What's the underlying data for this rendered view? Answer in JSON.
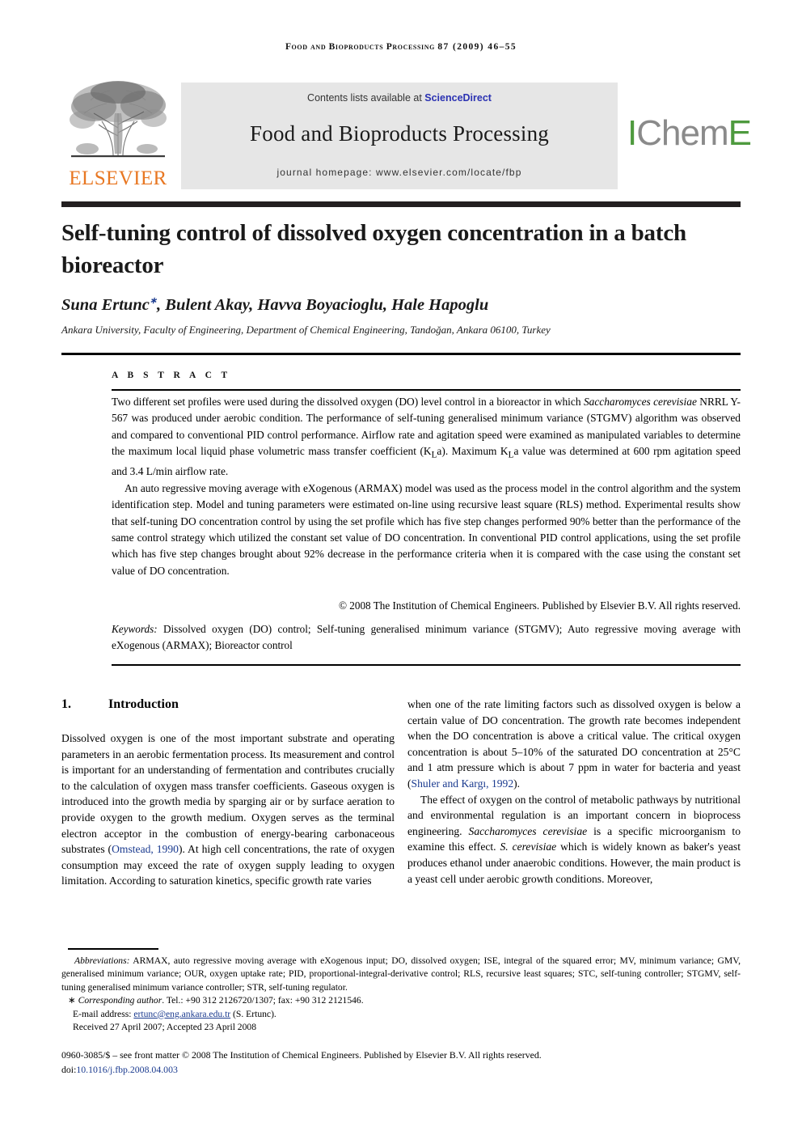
{
  "running_head": {
    "journal": "Food and Bioproducts Processing",
    "volume_issue": "87  (2009) 46–55"
  },
  "masthead": {
    "elsevier_wordmark": "ELSEVIER",
    "elsevier_logo_icon": "elsevier-tree-logo",
    "contents_prefix": "Contents lists available at ",
    "sciencedirect": "ScienceDirect",
    "journal_title": "Food and Bioproducts Processing",
    "homepage": "journal homepage: www.elsevier.com/locate/fbp",
    "icheme_part1": "I",
    "icheme_part2": "Chem",
    "icheme_part3": "E",
    "accent_green": "#4e9a3e",
    "accent_gray": "#8a8a8a",
    "elsevier_orange": "#E87722",
    "link_blue": "#2b32b2"
  },
  "article": {
    "title": "Self-tuning control of dissolved oxygen concentration in a batch bioreactor",
    "authors": "Suna Ertunc",
    "authors_rest": ", Bulent Akay, Havva Boyacioglu, Hale Hapoglu",
    "corresponding_marker": "∗",
    "affiliation": "Ankara University, Faculty of Engineering, Department of Chemical Engineering, Tandoğan, Ankara 06100, Turkey"
  },
  "abstract": {
    "label": "A B S T R A C T",
    "para1_a": "Two different set profiles were used during the dissolved oxygen (DO) level control in a bioreactor in which ",
    "para1_italic1": "Saccharomyces cerevisiae",
    "para1_b": " NRRL Y-567 was produced under aerobic condition. The performance of self-tuning generalised minimum variance (STGMV) algorithm was observed and compared to conventional PID control performance. Airflow rate and agitation speed were examined as manipulated variables to determine the maximum local liquid phase volumetric mass transfer coefficient (K",
    "para1_sub1": "L",
    "para1_c": "a). Maximum K",
    "para1_sub2": "L",
    "para1_d": "a value was determined at 600 rpm agitation speed and 3.4 L/min airflow rate.",
    "para2": "An auto regressive moving average with eXogenous (ARMAX) model was used as the process model in the control algorithm and the system identification step. Model and tuning parameters were estimated on-line using recursive least square (RLS) method. Experimental results show that self-tuning DO concentration control by using the set profile which has five step changes performed 90% better than the performance of the same control strategy which utilized the constant set value of DO concentration. In conventional PID control applications, using the set profile which has five step changes brought about 92% decrease in the performance criteria when it is compared with the case using the constant set value of DO concentration.",
    "copyright": "© 2008 The Institution of Chemical Engineers. Published by Elsevier B.V. All rights reserved.",
    "keywords_label": "Keywords:",
    "keywords_text": "  Dissolved oxygen (DO) control; Self-tuning generalised minimum variance (STGMV); Auto regressive moving average with eXogenous (ARMAX); Bioreactor control"
  },
  "body": {
    "section_number": "1.",
    "section_title": "Introduction",
    "left_para1_a": "Dissolved oxygen is one of the most important substrate and operating parameters in an aerobic fermentation process. Its measurement and control is important for an understanding of fermentation and contributes crucially to the calculation of oxygen mass transfer coefficients. Gaseous oxygen is introduced into the growth media by sparging air or by surface aeration to provide oxygen to the growth medium. Oxygen serves as the terminal electron acceptor in the combustion of energy-bearing carbonaceous substrates (",
    "left_cite1": "Omstead, 1990",
    "left_para1_b": "). At high cell concentrations, the rate of oxygen consumption may exceed the rate of oxygen supply leading to oxygen limitation. According to saturation kinetics, specific growth rate varies",
    "right_para1_a": "when one of the rate limiting factors such as dissolved oxygen is below a certain value of DO concentration. The growth rate becomes independent when the DO concentration is above a critical value. The critical oxygen concentration is about 5–10% of the saturated DO concentration at 25°C and 1 atm pressure which is about 7 ppm in water for bacteria and yeast (",
    "right_cite1": "Shuler and Kargı, 1992",
    "right_para1_b": ").",
    "right_para2_a": "The effect of oxygen on the control of metabolic pathways by nutritional and environmental regulation is an important concern in bioprocess engineering. ",
    "right_para2_italic1": "Saccharomyces cerevisiae",
    "right_para2_b": " is a specific microorganism to examine this effect. ",
    "right_para2_italic2": "S. cerevisiae",
    "right_para2_c": " which is widely known as baker's yeast produces ethanol under anaerobic conditions. However, the main product is a yeast cell under aerobic growth conditions. Moreover,"
  },
  "footnotes": {
    "abbr_label": "Abbreviations:",
    "abbr_text": " ARMAX, auto regressive moving average with eXogenous input; DO, dissolved oxygen; ISE, integral of the squared error; MV, minimum variance; GMV, generalised minimum variance; OUR, oxygen uptake rate; PID, proportional-integral-derivative control; RLS, recursive least squares; STC, self-tuning controller; STGMV, self-tuning generalised minimum variance controller; STR, self-tuning regulator.",
    "corresponding_marker": "∗",
    "corresponding_label": "Corresponding author",
    "corresponding_text": ". Tel.: +90 312 2126720/1307; fax: +90 312 2121546.",
    "email_label": "E-mail address:",
    "email_address": "ertunc@eng.ankara.edu.tr",
    "email_suffix": " (S. Ertunc).",
    "received": "Received 27 April 2007; Accepted 23 April 2008",
    "issn_line": "0960-3085/$ – see front matter © 2008 The Institution of Chemical Engineers. Published by Elsevier B.V. All rights reserved.",
    "doi_label": "doi:",
    "doi_value": "10.1016/j.fbp.2008.04.003"
  }
}
